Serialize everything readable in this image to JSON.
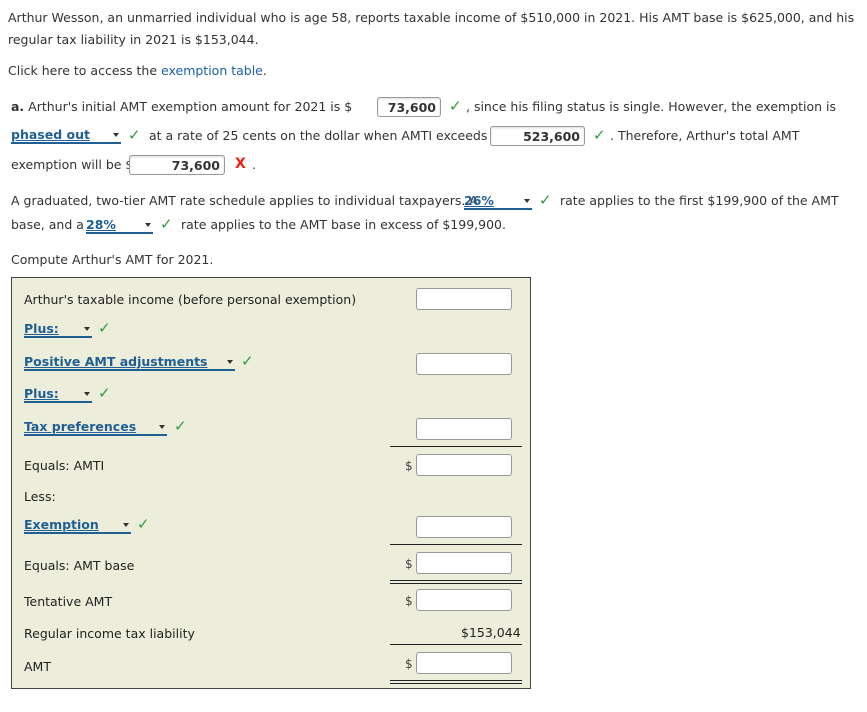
{
  "intro": {
    "line1": "Arthur Wesson, an unmarried individual who is age 58, reports taxable income of $510,000 in 2021. His AMT base is $625,000, and his",
    "line2": "regular tax liability in 2021 is $153,044.",
    "click_prefix": "Click here to access the ",
    "link": "exemption table",
    "click_suffix": "."
  },
  "part_a": {
    "label": "a.",
    "t1": " Arthur's initial AMT exemption amount for 2021 is $",
    "initial_exemption": "73,600",
    "t2": ", since his filing status is single. However, the exemption is",
    "phase_select": "phased out",
    "t3": "at a rate of 25 cents on the dollar when AMTI exceeds $",
    "threshold": "523,600",
    "t4": ". Therefore, Arthur's total AMT",
    "t5": "exemption will be $",
    "total_exemption": "73,600",
    "t6": "."
  },
  "rates": {
    "t1": "A graduated, two-tier AMT rate schedule applies to individual taxpayers. A",
    "rate1": "26%",
    "t2": "rate applies to the first $199,900 of the AMT",
    "t3": "base, and a",
    "rate2": "28%",
    "t4": "rate applies to the AMT base in excess of $199,900."
  },
  "compute": "Compute Arthur's AMT for 2021.",
  "table": {
    "taxable_income": "Arthur's taxable income (before personal exemption)",
    "plus1": "Plus:",
    "pos_adj": "Positive AMT adjustments",
    "plus2": "Plus:",
    "tax_pref": "Tax preferences",
    "amti": "Equals: AMTI",
    "less": "Less:",
    "exemption": "Exemption",
    "amt_base": "Equals: AMT base",
    "tentative": "Tentative AMT",
    "regular": "Regular income tax liability",
    "regular_value": "$153,044",
    "amt": "AMT",
    "dollar": "$"
  },
  "marks": {
    "check": "✓",
    "cross": "X"
  },
  "colors": {
    "correct": "#2e9b3a",
    "incorrect": "#e21",
    "select": "#1f5f93",
    "table_bg": "#ededdc"
  }
}
